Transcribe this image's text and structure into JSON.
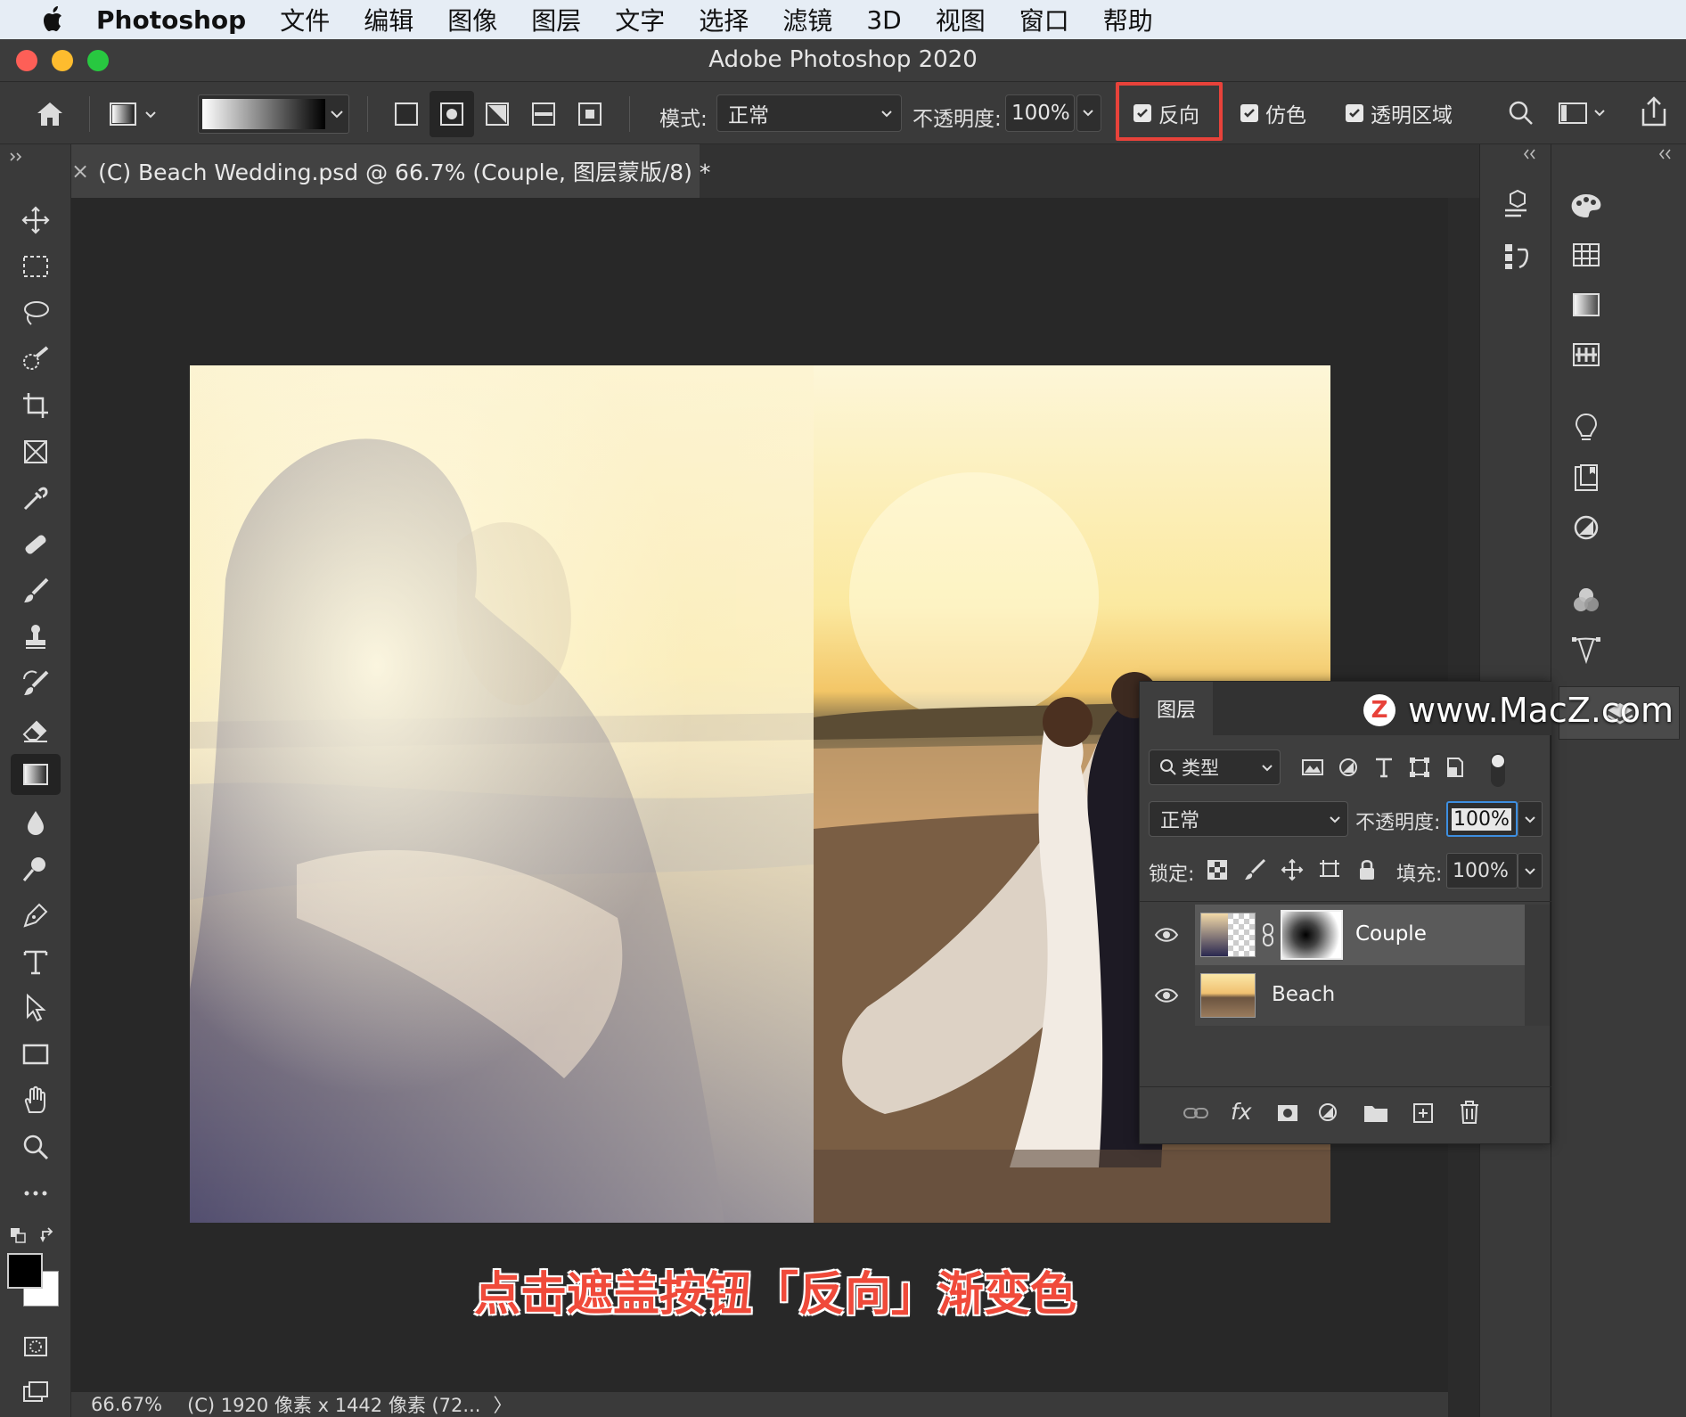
{
  "menubar": {
    "app_name": "Photoshop",
    "items": [
      "文件",
      "编辑",
      "图像",
      "图层",
      "文字",
      "选择",
      "滤镜",
      "3D",
      "视图",
      "窗口",
      "帮助"
    ]
  },
  "window": {
    "title": "Adobe Photoshop 2020"
  },
  "options": {
    "mode_label": "模式:",
    "mode_value": "正常",
    "opacity_label": "不透明度:",
    "opacity_value": "100%",
    "reverse_label": "反向",
    "dither_label": "仿色",
    "transparency_label": "透明区域"
  },
  "document": {
    "tab_title": "(C) Beach Wedding.psd @ 66.7% (Couple, 图层蒙版/8) *",
    "close_glyph": "×"
  },
  "status": {
    "zoom": "66.67%",
    "info": "(C) 1920 像素 x 1442 像素 (72...",
    "arrow": "〉"
  },
  "layers_panel": {
    "tab": "图层",
    "filter_label": "类型",
    "blend_mode": "正常",
    "opacity_label": "不透明度:",
    "opacity_value": "100%",
    "lock_label": "锁定:",
    "fill_label": "填充:",
    "fill_value": "100%",
    "layers": [
      {
        "name": "Couple",
        "selected": true
      },
      {
        "name": "Beach",
        "selected": false
      }
    ]
  },
  "watermark": {
    "text": "www.MacZ.com",
    "logo": "Z"
  },
  "caption": {
    "text": "点击遮盖按钮「反向」渐变色"
  },
  "colors": {
    "accent_red": "#e8423a",
    "panel": "#3a3a3a",
    "canvas": "#282828",
    "caption_red": "#f04a3a"
  }
}
